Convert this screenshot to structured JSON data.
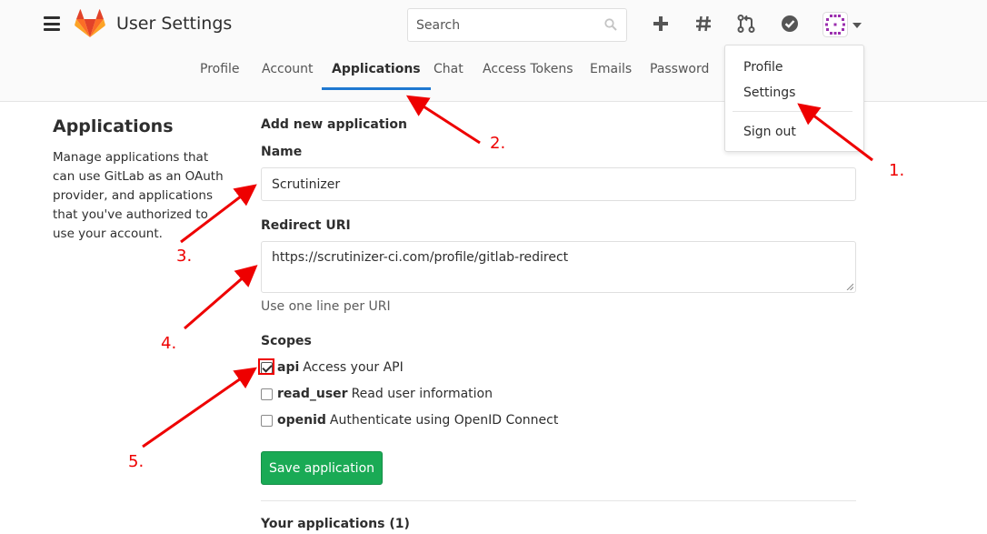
{
  "header": {
    "title": "User Settings",
    "search": {
      "placeholder": "Search",
      "value": ""
    },
    "icons": [
      "menu-icon",
      "gitlab-logo",
      "plus-icon",
      "hash-icon",
      "merge-request-icon",
      "todo-check-icon",
      "avatar",
      "caret-down-icon"
    ]
  },
  "tabs": [
    {
      "label": "Profile"
    },
    {
      "label": "Account"
    },
    {
      "label": "Applications",
      "active": true
    },
    {
      "label": "Chat"
    },
    {
      "label": "Access Tokens"
    },
    {
      "label": "Emails"
    },
    {
      "label": "Password"
    }
  ],
  "dropdown": {
    "profile": "Profile",
    "settings": "Settings",
    "sign_out": "Sign out"
  },
  "sidebar": {
    "title": "Applications",
    "description": "Manage applications that can use GitLab as an OAuth provider, and applications that you've authorized to use your account."
  },
  "form": {
    "heading": "Add new application",
    "name_label": "Name",
    "name_value": "Scrutinizer",
    "redirect_label": "Redirect URI",
    "redirect_value": "https://scrutinizer-ci.com/profile/gitlab-redirect",
    "redirect_help": "Use one line per URI",
    "scopes_label": "Scopes",
    "scopes": [
      {
        "name": "api",
        "desc": "Access your API",
        "checked": true
      },
      {
        "name": "read_user",
        "desc": "Read user information",
        "checked": false
      },
      {
        "name": "openid",
        "desc": "Authenticate using OpenID Connect",
        "checked": false
      }
    ],
    "save_label": "Save application"
  },
  "your_applications": "Your applications (1)",
  "annotations": {
    "step1": "1.",
    "step2": "2.",
    "step3": "3.",
    "step4": "4.",
    "step5": "5."
  },
  "colors": {
    "accent": "#1f78d1",
    "save_button": "#1aaa55",
    "annotation_red": "#ee0000",
    "avatar": "#9b2fae"
  }
}
